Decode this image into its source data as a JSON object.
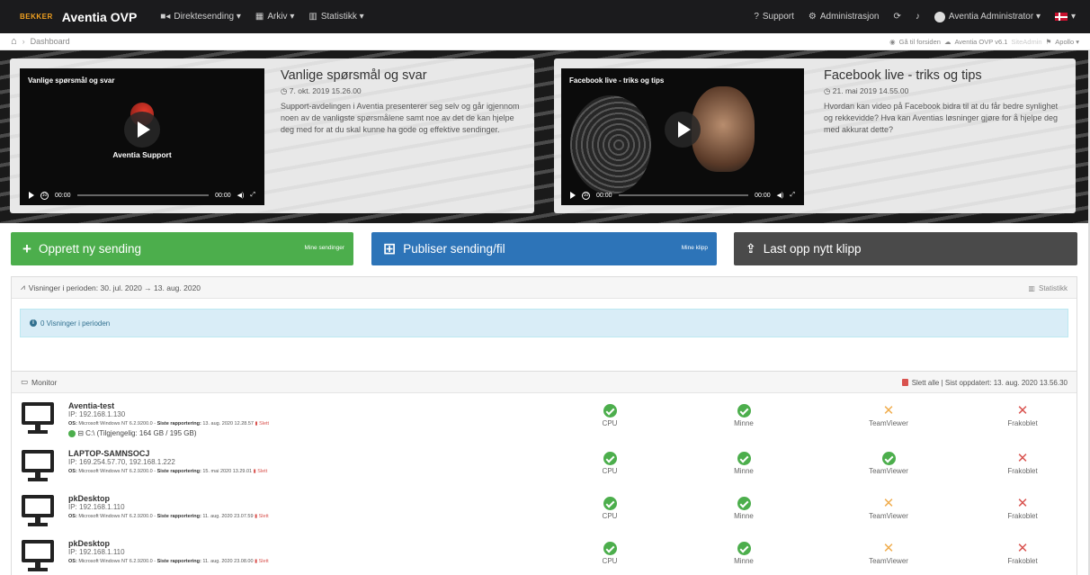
{
  "navbar": {
    "logo_text": "BEKKER",
    "brand": "Aventia OVP",
    "menu": [
      {
        "label": "Direktesending ▾",
        "icon": "video-camera-icon"
      },
      {
        "label": "Arkiv ▾",
        "icon": "archive-icon"
      },
      {
        "label": "Statistikk ▾",
        "icon": "chart-icon"
      }
    ],
    "support": "Support",
    "admin": "Administrasjon",
    "user": "Aventia Administrator ▾"
  },
  "breadcrumb": {
    "current": "Dashboard",
    "right_home": "Gå til forsiden",
    "version": "Aventia OVP v6.1",
    "sitename": "SiteAdmin",
    "apollo": "Apollo ▾"
  },
  "videos": [
    {
      "player_title": "Vanlige spørsmål og svar",
      "overlay_text": "Aventia Support",
      "title": "Vanlige spørsmål og svar",
      "date": "7. okt. 2019 15.26.00",
      "description": "Support-avdelingen i Aventia presenterer seg selv og går igjennom noen av de vanligste spørsmålene samt noe av det de kan hjelpe deg med for at du skal kunne ha gode og effektive sendinger.",
      "time_start": "00:00",
      "time_end": "00:00"
    },
    {
      "player_title": "Facebook live - triks og tips",
      "title": "Facebook live - triks og tips",
      "date": "21. mai 2019 14.55.00",
      "description": "Hvordan kan video på Facebook bidra til at du får bedre synlighet og rekkevidde? Hva kan Aventias løsninger gjøre for å hjelpe deg med akkurat dette?",
      "time_start": "00:00",
      "time_end": "00:00"
    }
  ],
  "actions": {
    "create": {
      "label": "Opprett ny sending",
      "sub": "Mine sendinger"
    },
    "publish": {
      "label": "Publiser sending/fil",
      "sub": "Mine klipp"
    },
    "upload": {
      "label": "Last opp nytt klipp"
    }
  },
  "views_panel": {
    "heading": "Visninger i perioden: 30. jul. 2020 → 13. aug. 2020",
    "stats_link": "Statistikk",
    "info": "0 Visninger i perioden"
  },
  "monitor": {
    "heading": "Monitor",
    "right": "Slett alle | Sist oppdatert: 13. aug. 2020 13.56.30",
    "labels": {
      "cpu": "CPU",
      "minne": "Minne",
      "teamviewer": "TeamViewer",
      "frakoblet": "Frakoblet"
    },
    "rows": [
      {
        "name": "Aventia-test",
        "ip": "IP: 192.168.1.130",
        "os": "Microsoft Windows NT 6.2.9200.0",
        "reported": "13. aug. 2020 12.28.57",
        "delete": "Slett",
        "disk": "C:\\ (Tilgjengelig: 164 GB / 195 GB)",
        "tv": "warn"
      },
      {
        "name": "LAPTOP-SAMNSOCJ",
        "ip": "IP: 169.254.57.70, 192.168.1.222",
        "os": "Microsoft Windows NT 6.2.9200.0",
        "reported": "15. mai 2020 13.29.01",
        "delete": "Slett",
        "tv": "ok"
      },
      {
        "name": "pkDesktop",
        "ip": "IP: 192.168.1.110",
        "os": "Microsoft Windows NT 6.2.9200.0",
        "reported": "11. aug. 2020 23.07.59",
        "delete": "Slett",
        "tv": "warn"
      },
      {
        "name": "pkDesktop",
        "ip": "IP: 192.168.1.110",
        "os": "Microsoft Windows NT 6.2.9200.0",
        "reported": "11. aug. 2020 23.08.00",
        "delete": "Slett",
        "tv": "warn"
      }
    ],
    "os_label": "OS:",
    "reported_label": "Siste rapportering:"
  },
  "colors": {
    "navbar": "#1b1b1d",
    "green": "#4cae4c",
    "blue": "#2d74b8",
    "gray": "#4a4a4a",
    "red": "#d9534f",
    "orange": "#f0ad4e"
  }
}
